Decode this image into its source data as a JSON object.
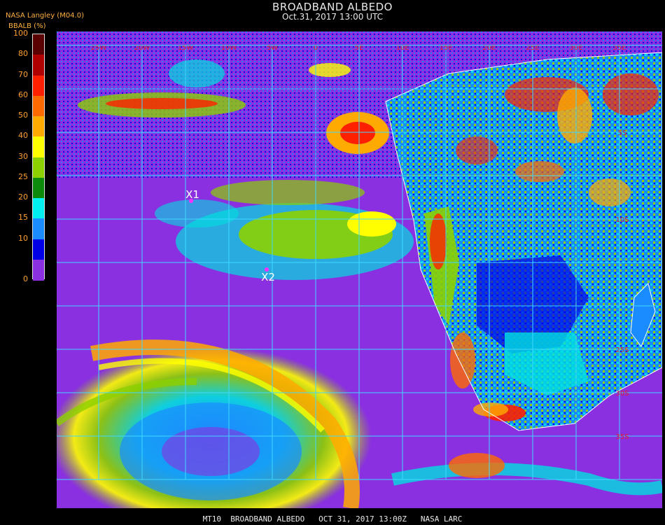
{
  "header": {
    "title": "BROADBAND ALBEDO",
    "subtitle": "Oct.31, 2017 13:00 UTC",
    "provider": "NASA Langley (M04.0)"
  },
  "colorbar": {
    "label": "BBALB (%)",
    "ticks": [
      "100",
      "80",
      "70",
      "60",
      "50",
      "40",
      "30",
      "25",
      "20",
      "15",
      "10",
      "0"
    ],
    "colors": [
      "#5a0000",
      "#b00000",
      "#ff2000",
      "#ff6a00",
      "#ffaa00",
      "#ffff00",
      "#8cd000",
      "#0c8a0c",
      "#00f0f0",
      "#1a8cff",
      "#0000e6",
      "#8a30e0"
    ]
  },
  "map": {
    "lon_labels": [
      "25W",
      "20W",
      "15W",
      "10W",
      "5W",
      "0",
      "5E",
      "10E",
      "15E",
      "20E",
      "25E",
      "30E",
      "35E"
    ],
    "lat_labels": [
      "5S",
      "10S",
      "25S",
      "30S",
      "35S"
    ],
    "markers": [
      {
        "label": "X1"
      },
      {
        "label": "X2"
      }
    ]
  },
  "footer": {
    "text": "MT10  BROADBAND ALBEDO   OCT 31, 2017 13:00Z   NASA LARC"
  }
}
